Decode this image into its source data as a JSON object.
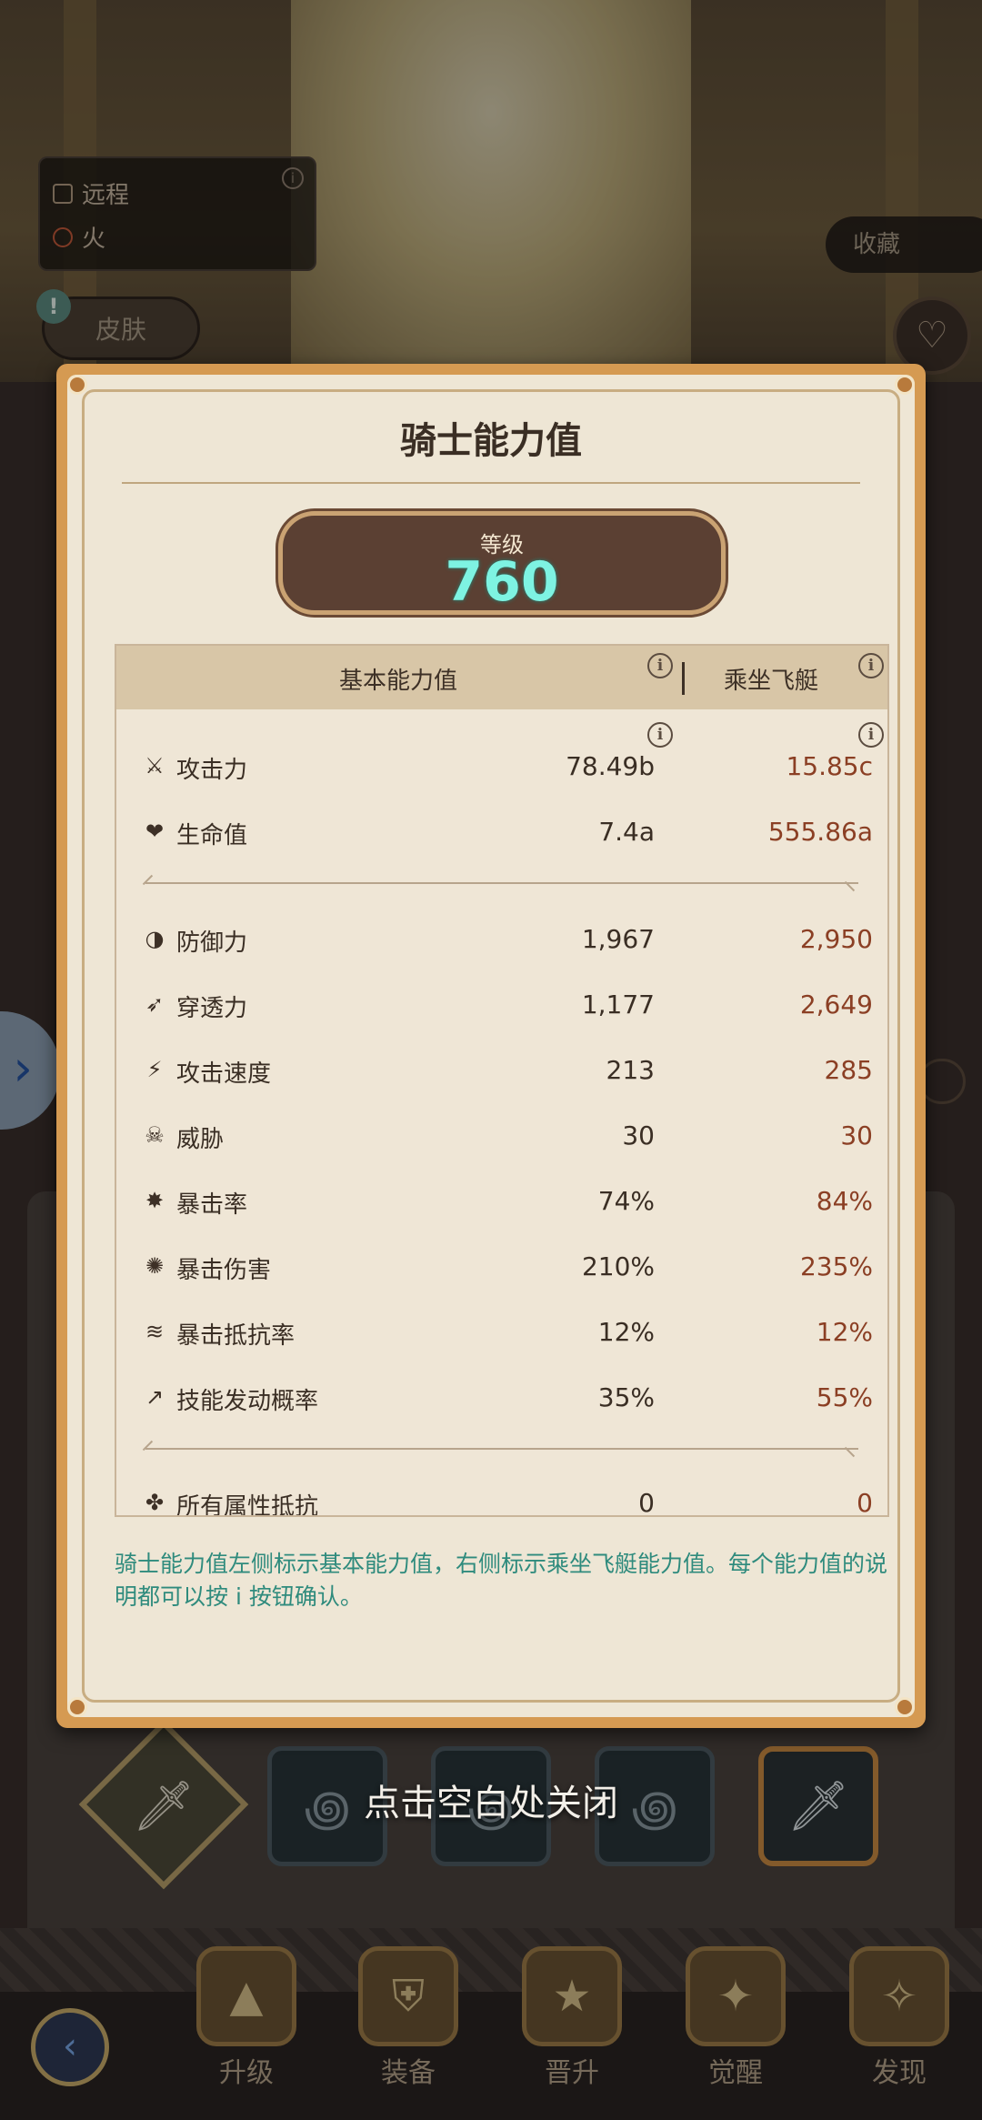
{
  "background": {
    "attack_type": "远程",
    "element": "火",
    "skin_button": "皮肤",
    "alert_mark": "!",
    "favorite_button": "收藏",
    "close_hint": "点击空白处关闭"
  },
  "bottom_nav": {
    "items": [
      {
        "label": "升级"
      },
      {
        "label": "装备"
      },
      {
        "label": "晋升"
      },
      {
        "label": "觉醒"
      },
      {
        "label": "发现"
      }
    ]
  },
  "modal": {
    "title": "骑士能力值",
    "level_label": "等级",
    "level_value": "760",
    "header_base": "基本能力值",
    "header_ride": "乘坐飞艇",
    "info_glyph": "i",
    "stats_group1": [
      {
        "icon": "sword-icon",
        "name": "攻击力",
        "base": "78.49b",
        "ride": "15.85c"
      },
      {
        "icon": "heart-icon",
        "name": "生命值",
        "base": "7.4a",
        "ride": "555.86a"
      }
    ],
    "stats_group2": [
      {
        "icon": "shield-half-icon",
        "name": "防御力",
        "base": "1,967",
        "ride": "2,950"
      },
      {
        "icon": "pierce-icon",
        "name": "穿透力",
        "base": "1,177",
        "ride": "2,649"
      },
      {
        "icon": "attack-speed-icon",
        "name": "攻击速度",
        "base": "213",
        "ride": "285"
      },
      {
        "icon": "threat-icon",
        "name": "威胁",
        "base": "30",
        "ride": "30"
      },
      {
        "icon": "crit-rate-icon",
        "name": "暴击率",
        "base": "74%",
        "ride": "84%"
      },
      {
        "icon": "crit-damage-icon",
        "name": "暴击伤害",
        "base": "210%",
        "ride": "235%"
      },
      {
        "icon": "crit-resist-icon",
        "name": "暴击抵抗率",
        "base": "12%",
        "ride": "12%"
      },
      {
        "icon": "skill-proc-icon",
        "name": "技能发动概率",
        "base": "35%",
        "ride": "55%"
      }
    ],
    "stats_group3": [
      {
        "icon": "all-resist-icon",
        "name": "所有属性抵抗",
        "base": "0",
        "ride": "0"
      }
    ],
    "note": "骑士能力值左侧标示基本能力值，右侧标示乘坐飞艇能力值。每个能力值的说明都可以按 i 按钮确认。"
  },
  "colors": {
    "accent_teal": "#2f8b7d",
    "level_value": "#7ef3e2",
    "ride_value": "#8b3f24",
    "modal_frame": "#d59a52"
  }
}
